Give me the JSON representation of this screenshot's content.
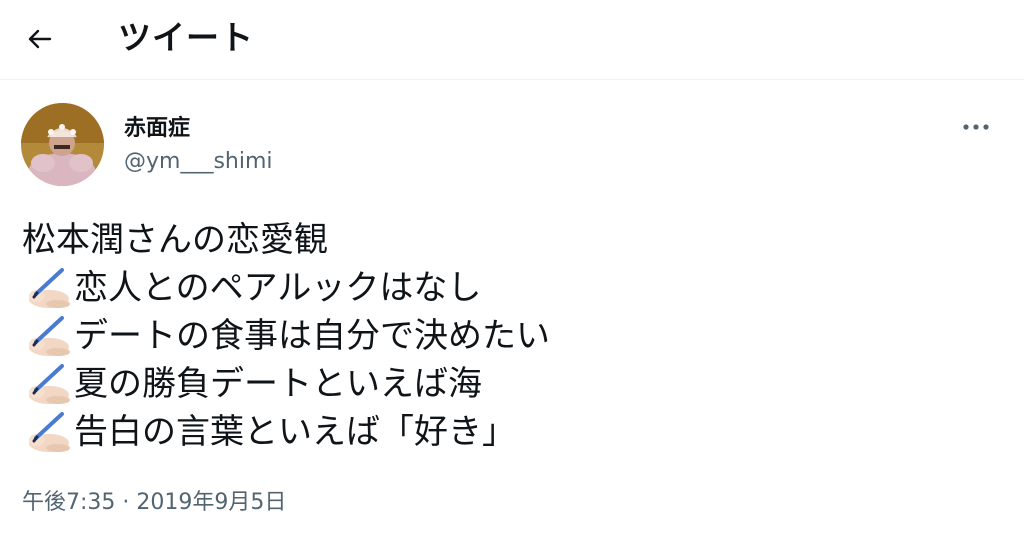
{
  "header": {
    "back_icon": "arrow-left-icon",
    "title": "ツイート"
  },
  "author": {
    "display_name": "赤面症",
    "handle": "@ym___shimi",
    "avatar_icon": "profile-photo"
  },
  "menu": {
    "more_icon": "more-horizontal-icon"
  },
  "tweet": {
    "lines": [
      {
        "icon": null,
        "text": "松本潤さんの恋愛観"
      },
      {
        "icon": "writing-hand-icon",
        "text": "恋人とのペアルックはなし"
      },
      {
        "icon": "writing-hand-icon",
        "text": "デートの食事は自分で決めたい"
      },
      {
        "icon": "writing-hand-icon",
        "text": "夏の勝負デートといえば海"
      },
      {
        "icon": "writing-hand-icon",
        "text": "告白の言葉といえば「好き」"
      }
    ]
  },
  "timestamp": "午後7:35 · 2019年9月5日",
  "colors": {
    "text": "#0f1419",
    "secondary": "#536471",
    "divider": "#eff3f4"
  }
}
